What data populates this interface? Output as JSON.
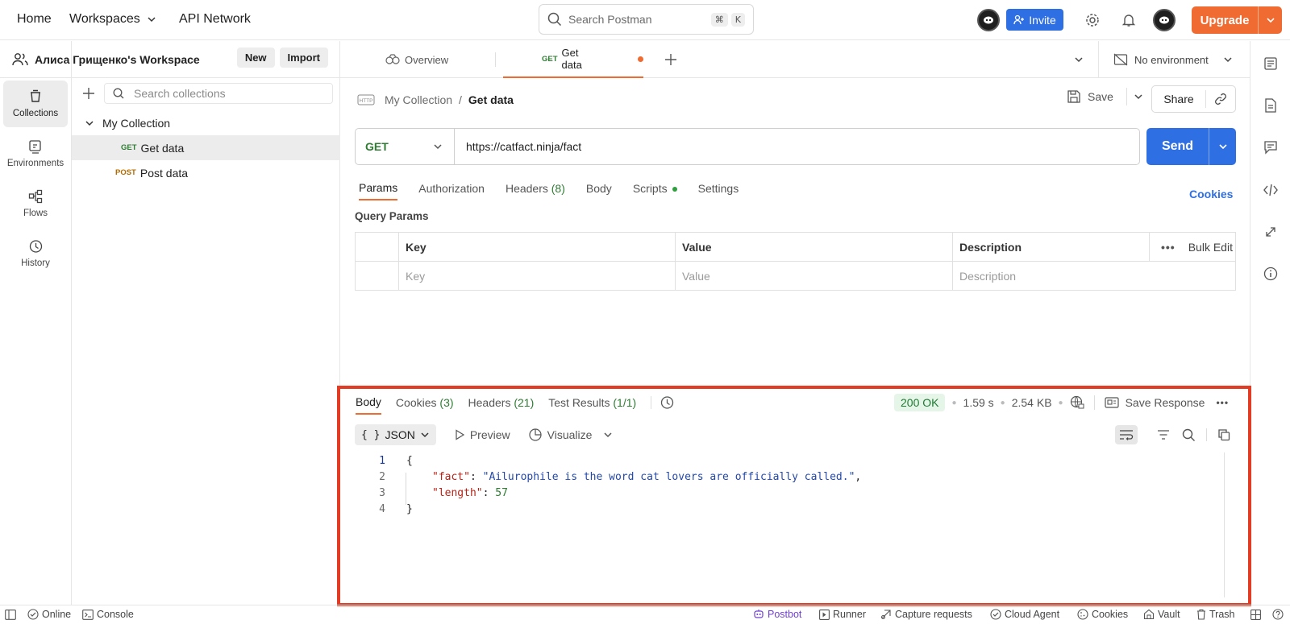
{
  "topbar": {
    "nav": [
      "Home",
      "Workspaces",
      "API Network"
    ],
    "search_placeholder": "Search Postman",
    "search_shortcut": [
      "⌘",
      "K"
    ],
    "invite_label": "Invite",
    "upgrade_label": "Upgrade"
  },
  "workspace": {
    "name": "Алиса Грищенко's Workspace",
    "new_label": "New",
    "import_label": "Import"
  },
  "left_rail": [
    {
      "label": "Collections",
      "icon": "collections-icon",
      "active": true
    },
    {
      "label": "Environments",
      "icon": "environments-icon"
    },
    {
      "label": "Flows",
      "icon": "flows-icon"
    },
    {
      "label": "History",
      "icon": "history-icon"
    }
  ],
  "collections": {
    "search_placeholder": "Search collections",
    "collection_name": "My Collection",
    "requests": [
      {
        "method": "GET",
        "name": "Get data",
        "selected": true
      },
      {
        "method": "POST",
        "name": "Post data"
      }
    ]
  },
  "tabs": {
    "overview": "Overview",
    "active_method": "GET",
    "active_name": "Get data",
    "environment": "No environment"
  },
  "request": {
    "breadcrumb_parent": "My Collection",
    "breadcrumb_sep": "/",
    "breadcrumb_current": "Get data",
    "save_label": "Save",
    "share_label": "Share",
    "method": "GET",
    "url": "https://catfact.ninja/fact",
    "send_label": "Send",
    "tabs": {
      "params": "Params",
      "authorization": "Authorization",
      "headers": "Headers",
      "headers_count": "(8)",
      "body": "Body",
      "scripts": "Scripts",
      "settings": "Settings"
    },
    "cookies_label": "Cookies",
    "query_params_label": "Query Params",
    "table": {
      "headers": [
        "Key",
        "Value",
        "Description"
      ],
      "bulk_edit": "Bulk Edit",
      "placeholders": [
        "Key",
        "Value",
        "Description"
      ]
    }
  },
  "response": {
    "tabs": {
      "body": "Body",
      "cookies": "Cookies",
      "cookies_count": "(3)",
      "headers": "Headers",
      "headers_count": "(21)",
      "tests": "Test Results",
      "tests_count": "(1/1)"
    },
    "status": "200 OK",
    "time": "1.59 s",
    "size": "2.54 KB",
    "save_response": "Save Response",
    "format": "JSON",
    "preview": "Preview",
    "visualize": "Visualize",
    "lines": [
      {
        "n": "1",
        "text": "{"
      },
      {
        "n": "2",
        "key": "\"fact\"",
        "value": "\"Ailurophile is the word cat lovers are officially called.\""
      },
      {
        "n": "3",
        "key": "\"length\"",
        "number": "57"
      },
      {
        "n": "4",
        "text": "}"
      }
    ]
  },
  "statusbar": {
    "online": "Online",
    "console": "Console",
    "postbot": "Postbot",
    "runner": "Runner",
    "capture": "Capture requests",
    "cloud_agent": "Cloud Agent",
    "cookies": "Cookies",
    "vault": "Vault",
    "trash": "Trash"
  },
  "colors": {
    "accent": "#f06b32",
    "primary": "#2f6fe4",
    "get": "#2e7d32",
    "post": "#b36b00",
    "highlight_frame": "#e23c24"
  }
}
